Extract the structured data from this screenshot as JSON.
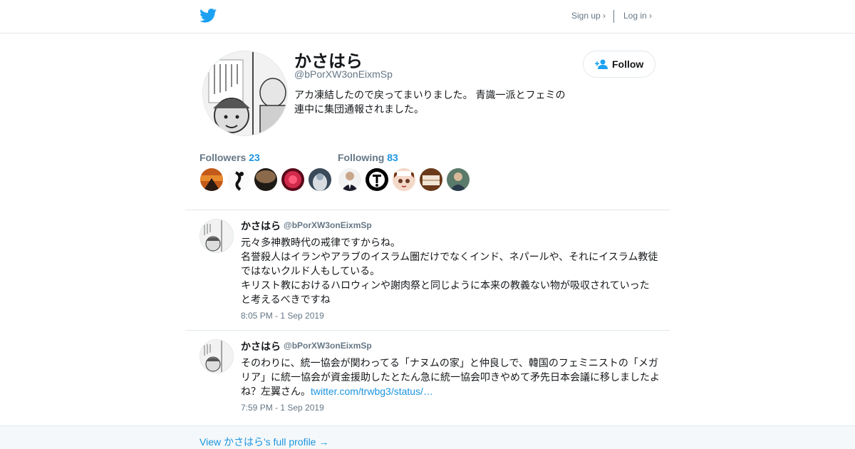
{
  "header": {
    "logo_icon": "twitter-bird-icon",
    "signup_label": "Sign up ›",
    "login_label": "Log in ›",
    "brand_color": "#1da1f2"
  },
  "profile": {
    "display_name": "かさはら",
    "screen_name": "@bPorXW3onEixmSp",
    "bio_lines": [
      "アカ凍結したので戻ってまいりました。 青識一派とフェミの",
      "連中に集団通報されました。"
    ],
    "follow_label": "Follow",
    "follow_icon": "add-user-icon",
    "followers_label": "Followers",
    "followers_count": "23",
    "following_label": "Following",
    "following_count": "83",
    "link_color": "#1b95e0"
  },
  "tweets": [
    {
      "name": "かさはら",
      "handle": "@bPorXW3onEixmSp",
      "lines": [
        "元々多神教時代の戒律ですからね。",
        "名誉殺人はイランやアラブのイスラム圏だけでなくインド、ネパールや、それにイスラム教徒",
        "ではないクルド人もしている。",
        "キリスト教におけるハロウィンや謝肉祭と同じように本来の教義ない物が吸収されていった",
        "と考えるべきですね"
      ],
      "time": "8:05 PM - 1 Sep 2019"
    },
    {
      "name": "かさはら",
      "handle": "@bPorXW3onEixmSp",
      "lines": [
        "そのわりに、統一協会が関わってる「ナヌムの家」と仲良しで、韓国のフェミニストの「メガ",
        "リア」に統一協会が資金援助したとたん急に統一協会叩きやめて矛先日本会議に移しましたよ",
        "ね？左翼さん。"
      ],
      "link": "twitter.com/trwbg3/status/…",
      "time": "7:59 PM - 1 Sep 2019"
    }
  ],
  "footer": {
    "full_profile_link": "View かさはら's full profile →"
  }
}
